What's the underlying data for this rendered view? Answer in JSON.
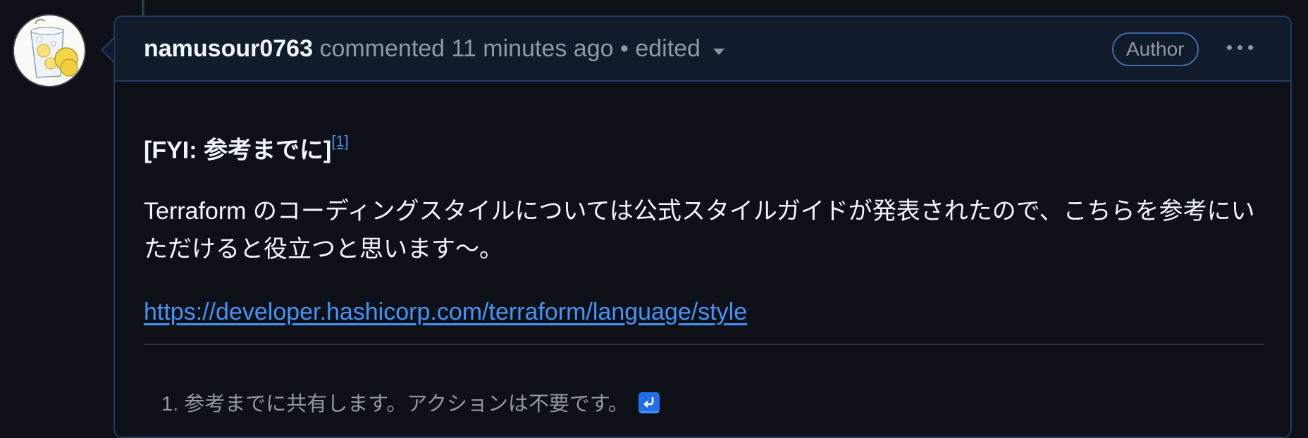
{
  "comment": {
    "author": "namusour0763",
    "action": "commented",
    "time": "11 minutes ago",
    "separator": "•",
    "edited": "edited",
    "badge": "Author",
    "heading": "[FYI: 参考までに]",
    "footnote_ref": "[1]",
    "body_text": "Terraform のコーディングスタイルについては公式スタイルガイドが発表されたので、こちらを参考にいただけると役立つと思います〜。",
    "link_text": "https://developer.hashicorp.com/terraform/language/style",
    "footnotes": [
      {
        "number": "1.",
        "text": "参考までに共有します。アクションは不要です。"
      }
    ]
  },
  "colors": {
    "background": "#0d1117",
    "header_background": "#121b2b",
    "border": "#1f3a66",
    "link": "#4493f8",
    "muted": "#9198a1",
    "text": "#f0f6fc"
  },
  "icons": {
    "avatar": "lemon-sour-glass-avatar",
    "menu": "kebab-horizontal-icon",
    "dropdown": "triangle-down-icon",
    "backref": "return-arrow-icon"
  }
}
